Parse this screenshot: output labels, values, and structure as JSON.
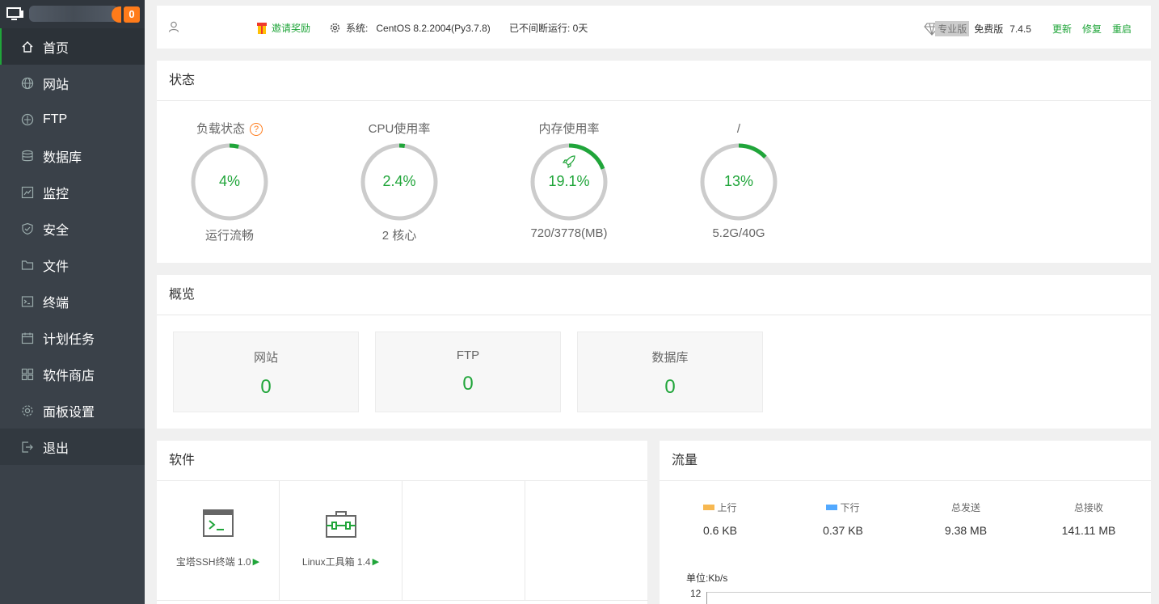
{
  "sidebar": {
    "badge": "0",
    "items": [
      {
        "label": "首页",
        "icon": "home-icon",
        "active": true
      },
      {
        "label": "网站",
        "icon": "globe-icon"
      },
      {
        "label": "FTP",
        "icon": "ftp-icon"
      },
      {
        "label": "数据库",
        "icon": "database-icon"
      },
      {
        "label": "监控",
        "icon": "monitor-chart-icon"
      },
      {
        "label": "安全",
        "icon": "shield-icon"
      },
      {
        "label": "文件",
        "icon": "folder-icon"
      },
      {
        "label": "终端",
        "icon": "terminal-icon"
      },
      {
        "label": "计划任务",
        "icon": "calendar-icon"
      },
      {
        "label": "软件商店",
        "icon": "apps-icon"
      },
      {
        "label": "面板设置",
        "icon": "gear-icon"
      },
      {
        "label": "退出",
        "icon": "logout-icon"
      }
    ]
  },
  "header": {
    "invite": "邀请奖励",
    "system_label": "系统:",
    "system_value": "CentOS 8.2.2004(Py3.7.8)",
    "uptime": "已不间断运行: 0天",
    "pro_tag": "专业版",
    "free": "免费版",
    "version": "7.4.5",
    "update": "更新",
    "repair": "修复",
    "restart": "重启"
  },
  "status": {
    "title": "状态",
    "gauges": [
      {
        "label": "负载状态",
        "value": "4%",
        "percent": 4,
        "sub": "运行流畅"
      },
      {
        "label": "CPU使用率",
        "value": "2.4%",
        "percent": 2.4,
        "sub": "2 核心"
      },
      {
        "label": "内存使用率",
        "value": "19.1%",
        "percent": 19.1,
        "sub": "720/3778(MB)"
      },
      {
        "label": "/",
        "value": "13%",
        "percent": 13,
        "sub": "5.2G/40G"
      }
    ]
  },
  "overview": {
    "title": "概览",
    "cards": [
      {
        "name": "网站",
        "count": "0"
      },
      {
        "name": "FTP",
        "count": "0"
      },
      {
        "name": "数据库",
        "count": "0"
      }
    ]
  },
  "software": {
    "title": "软件",
    "items": [
      {
        "name": "宝塔SSH终端 1.0",
        "icon": "terminal-window-icon"
      },
      {
        "name": "Linux工具箱 1.4",
        "icon": "toolbox-icon"
      }
    ]
  },
  "traffic": {
    "title": "流量",
    "up_label": "上行",
    "up_value": "0.6 KB",
    "down_label": "下行",
    "down_value": "0.37 KB",
    "sent_label": "总发送",
    "sent_value": "9.38 MB",
    "recv_label": "总接收",
    "recv_value": "141.11 MB",
    "unit": "单位:Kb/s",
    "ytick": "12",
    "colors": {
      "up": "#f7b851",
      "down": "#52a9ff"
    }
  },
  "colors": {
    "accent": "#20a53a",
    "sidebar": "#3a4149",
    "badge": "#ff7b1a"
  }
}
